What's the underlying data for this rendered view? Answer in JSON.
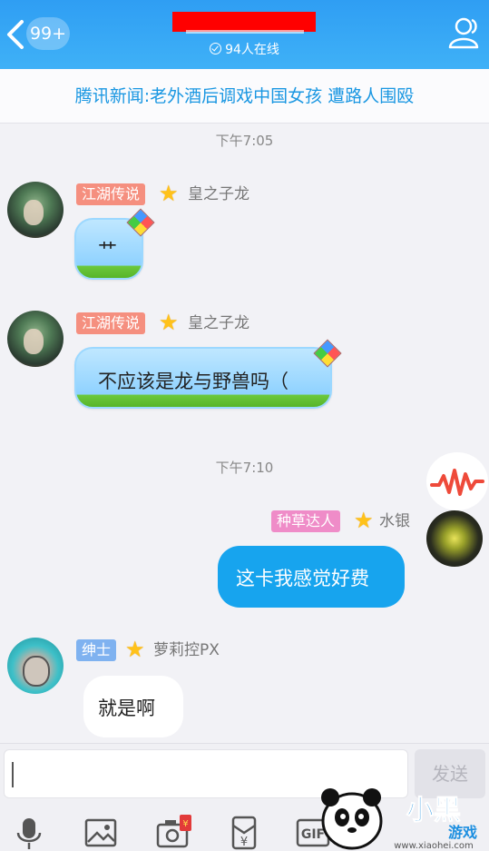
{
  "header": {
    "unread_badge": "99+",
    "online_text": "94人在线"
  },
  "news_banner": "腾讯新闻:老外酒后调戏中国女孩 遭路人围殴",
  "messages": [
    {
      "time": "下午7:05"
    },
    {
      "tag": "江湖传说",
      "nickname": "皇之子龙",
      "text": "艹"
    },
    {
      "tag": "江湖传说",
      "nickname": "皇之子龙",
      "text": "不应该是龙与野兽吗（"
    },
    {
      "time": "下午7:10"
    },
    {
      "tag": "种草达人",
      "nickname": "水银",
      "text": "这卡我感觉好费"
    },
    {
      "tag": "绅士",
      "nickname": "萝莉控PX",
      "text": "就是啊"
    }
  ],
  "composer": {
    "send_label": "发送",
    "tools": [
      "microphone-icon",
      "image-icon",
      "camera-icon",
      "red-packet-icon",
      "gif-icon"
    ]
  },
  "watermark": {
    "brand": "小黑游戏",
    "url": "www.xiaohei.com"
  },
  "colors": {
    "header": "#2f9ef3",
    "news_text": "#1a97e2",
    "my_bubble": "#17a4ee",
    "tag_orange": "#f58f7f",
    "tag_pink": "#ef8cc8",
    "tag_blue": "#7fb2f0"
  }
}
